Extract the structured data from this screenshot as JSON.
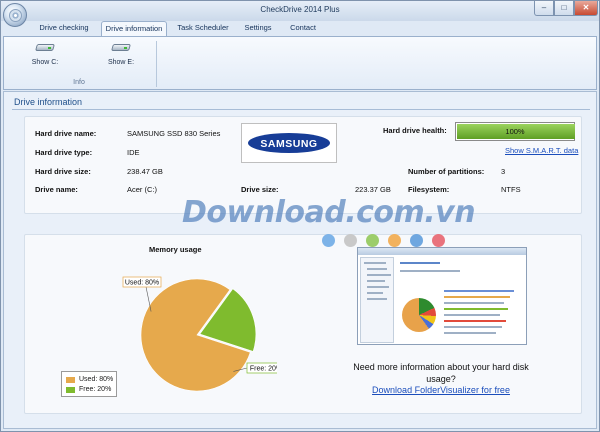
{
  "window": {
    "title": "CheckDrive 2014 Plus"
  },
  "window_controls": {
    "minimize": "–",
    "maximize": "□",
    "close": "✕"
  },
  "tabs": [
    {
      "label": "Drive checking"
    },
    {
      "label": "Drive information"
    },
    {
      "label": "Task Scheduler"
    },
    {
      "label": "Settings"
    },
    {
      "label": "Contact"
    }
  ],
  "active_tab_index": 1,
  "ribbon": {
    "buttons": [
      {
        "label": "Show C:",
        "icon": "hard-drive-icon"
      },
      {
        "label": "Show E:",
        "icon": "hard-drive-icon"
      }
    ],
    "group_label": "Info"
  },
  "section": {
    "title": "Drive information"
  },
  "drive_info": {
    "hard_drive_name_label": "Hard drive name:",
    "hard_drive_name": "SAMSUNG SSD 830 Series",
    "hard_drive_type_label": "Hard drive type:",
    "hard_drive_type": "IDE",
    "hard_drive_size_label": "Hard drive size:",
    "hard_drive_size": "238.47 GB",
    "drive_name_label": "Drive name:",
    "drive_name": "Acer (C:)",
    "drive_size_label": "Drive size:",
    "drive_size": "223.37 GB",
    "filesystem_label": "Filesystem:",
    "filesystem": "NTFS",
    "partitions_label": "Number of partitions:",
    "partitions": "3",
    "health_label": "Hard drive health:",
    "health_text": "100%",
    "health_fraction": 1.0,
    "smart_link": "Show S.M.A.R.T. data",
    "brand_logo_text": "SAMSUNG"
  },
  "chart_data": {
    "type": "pie",
    "title": "Memory usage",
    "slices": [
      {
        "name": "Used",
        "label": "Used: 80%",
        "value": 80,
        "color": "#e6a94c"
      },
      {
        "name": "Free",
        "label": "Free: 20%",
        "value": 20,
        "color": "#7fbb2e"
      }
    ],
    "legend": [
      {
        "label": "Used: 80%",
        "color": "#e6a94c"
      },
      {
        "label": "Free: 20%",
        "color": "#7fbb2e"
      }
    ],
    "legend_position": "bottom-left"
  },
  "promo": {
    "text": "Need more information about your hard disk usage?",
    "link": "Download FolderVisualizer for free"
  },
  "watermark": {
    "text": "Download.com.vn",
    "dot_colors": [
      "#7db3e8",
      "#c9c9c9",
      "#9ccd6a",
      "#f2b25e",
      "#6fa7e0",
      "#e9737d"
    ]
  },
  "colors": {
    "accent": "#1f4f8a",
    "link": "#1a4dbb",
    "health_bar": "#6fb02d",
    "close_button": "#c74a32"
  }
}
